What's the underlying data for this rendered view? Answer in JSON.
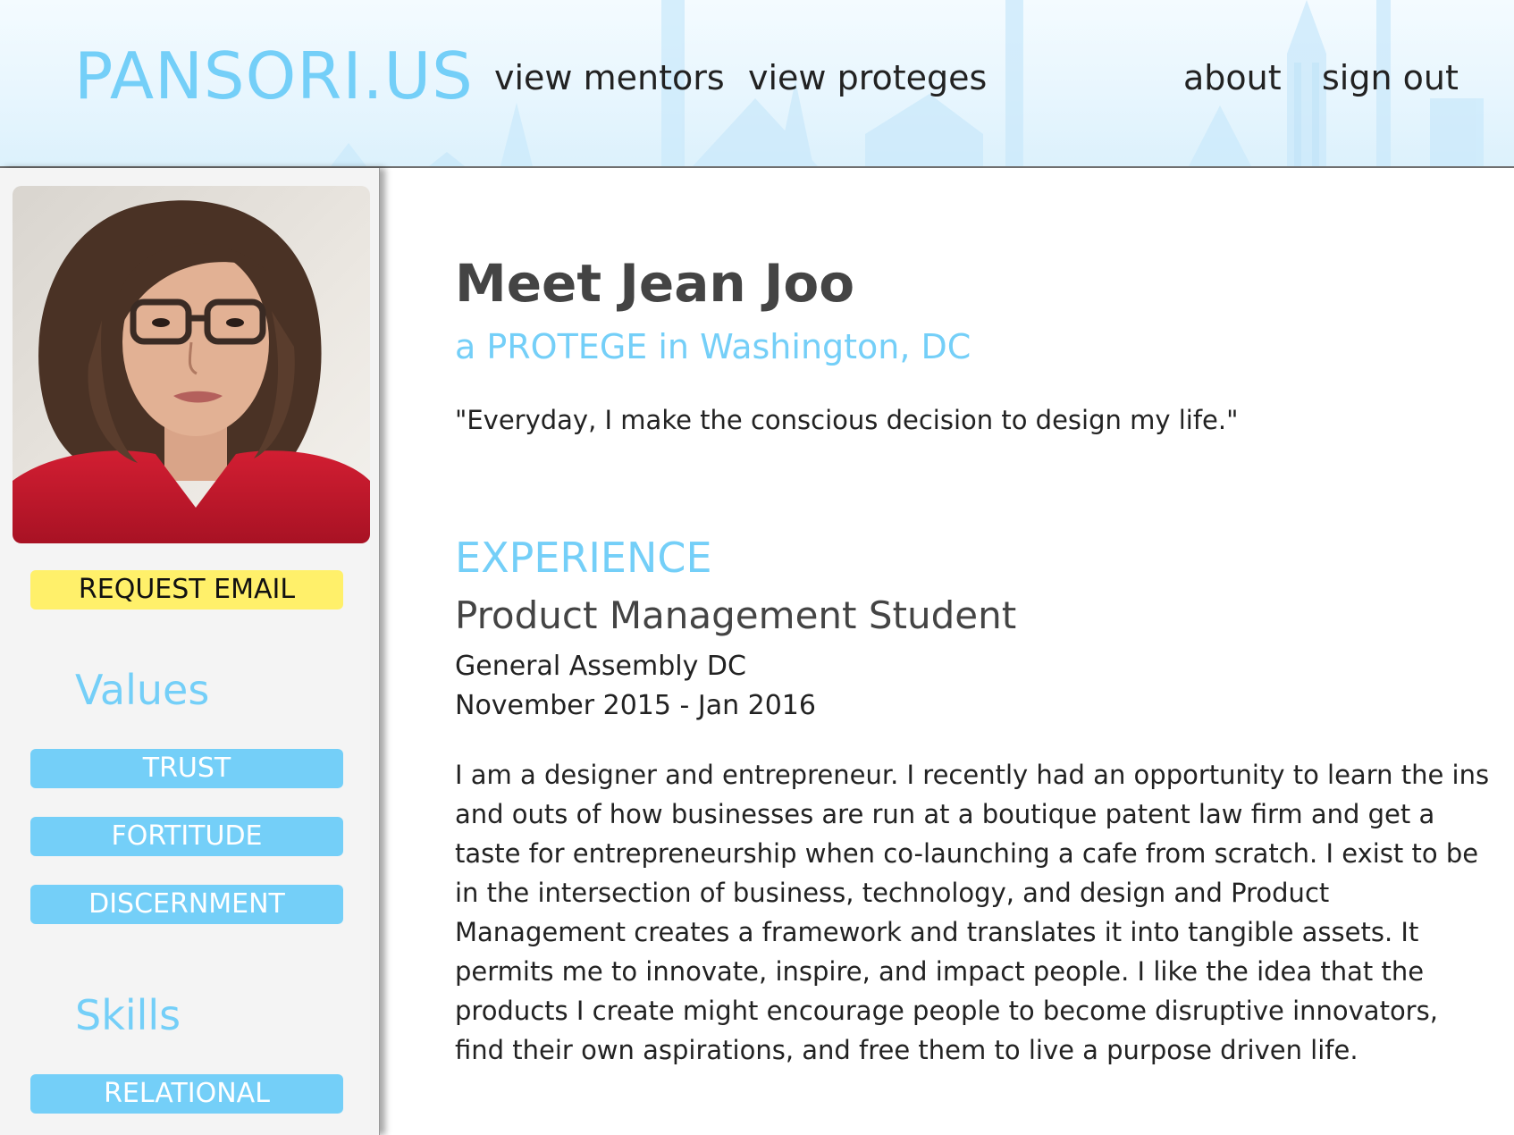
{
  "header": {
    "logo": "PANSORI.US",
    "nav": {
      "view_mentors": "view mentors",
      "view_proteges": "view proteges",
      "about": "about",
      "sign_out": "sign out"
    }
  },
  "sidebar": {
    "request_email_label": "REQUEST EMAIL",
    "values_heading": "Values",
    "values": [
      "TRUST",
      "FORTITUDE",
      "DISCERNMENT"
    ],
    "skills_heading": "Skills",
    "skills": [
      "RELATIONAL"
    ]
  },
  "profile": {
    "heading": "Meet Jean Joo",
    "subtitle": "a PROTEGE in Washington, DC",
    "quote": "\"Everyday, I make the conscious decision to design my life.\""
  },
  "experience": {
    "heading": "EXPERIENCE",
    "title": "Product Management Student",
    "organization": "General Assembly DC",
    "dates": "November 2015 - Jan 2016",
    "description_lines": [
      "I am a designer and entrepreneur. I recently had an opportunity to learn the ins",
      "and outs of how businesses are run at a boutique patent law firm and get a",
      "taste for entrepreneurship when co-launching a cafe from scratch. I exist to be",
      "in the intersection of business, technology, and design and Product",
      "Management creates a framework and translates it into tangible assets. It",
      "permits me to innovate, inspire, and impact people. I like the idea that the",
      "products I create might encourage people to become disruptive innovators,",
      "find their own aspirations, and free them to live a purpose driven life."
    ]
  },
  "colors": {
    "accent": "#74cff8",
    "request_button": "#fff06a",
    "heading_gray": "#444444",
    "text": "#222222",
    "sidebar_bg": "#f4f4f4"
  }
}
